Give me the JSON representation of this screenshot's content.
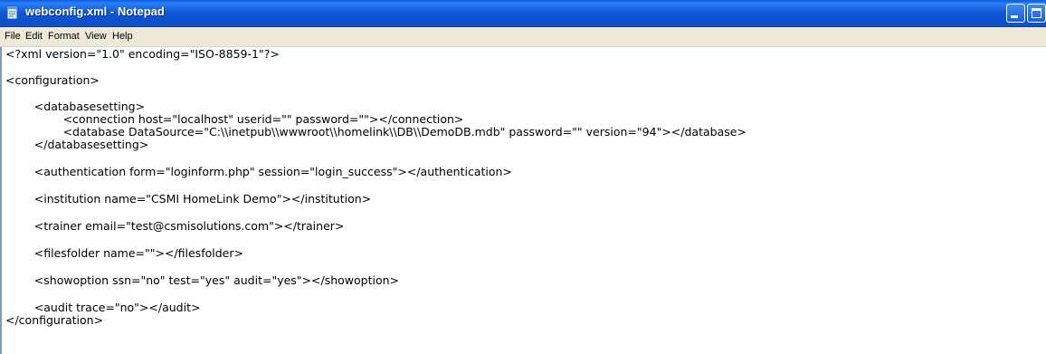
{
  "window": {
    "title": "webconfig.xml - Notepad",
    "icon": "notepad-icon",
    "controls": [
      "minimize-icon",
      "maximize-icon"
    ]
  },
  "menu": {
    "file": "File",
    "edit": "Edit",
    "format": "Format",
    "view": "View",
    "help": "Help"
  },
  "editor": {
    "lines": [
      "<?xml version=\"1.0\" encoding=\"ISO-8859-1\"?>",
      "<configuration>",
      "        <databasesetting>",
      "                <connection host=\"localhost\" userid=\"\" password=\"\"></connection>",
      "                <database DataSource=\"C:\\\\inetpub\\\\wwwroot\\\\homelink\\\\DB\\\\DemoDB.mdb\" password=\"\" version=\"94\"></database>",
      "        </databasesetting>",
      "        <authentication form=\"loginform.php\" session=\"login_success\"></authentication>",
      "        <institution name=\"CSMI HomeLink Demo\"></institution>",
      "        <trainer email=\"test@csmisolutions.com\"></trainer>",
      "        <filesfolder name=\"\"></filesfolder>",
      "        <showoption ssn=\"no\" test=\"yes\" audit=\"yes\"></showoption>",
      "        <audit trace=\"no\"></audit>",
      "</configuration>"
    ]
  }
}
